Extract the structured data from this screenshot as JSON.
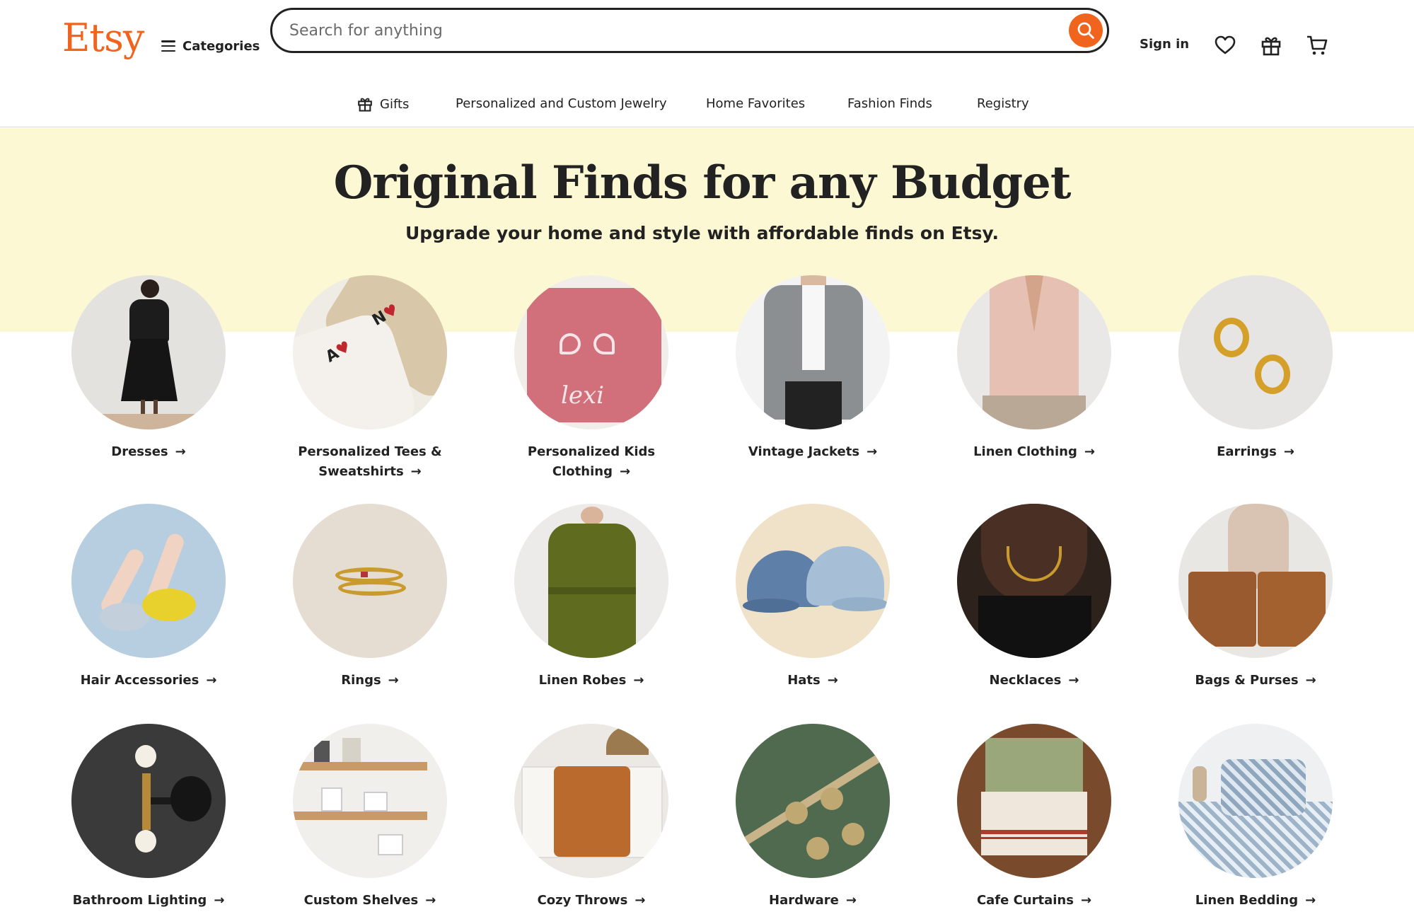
{
  "header": {
    "logo": "Etsy",
    "categories_label": "Categories",
    "search_placeholder": "Search for anything",
    "sign_in": "Sign in"
  },
  "subnav": [
    {
      "label": "Gifts"
    },
    {
      "label": "Personalized and Custom Jewelry"
    },
    {
      "label": "Home Favorites"
    },
    {
      "label": "Fashion Finds"
    },
    {
      "label": "Registry"
    }
  ],
  "hero": {
    "title": "Original Finds for any Budget",
    "subtitle": "Upgrade your home and style with affordable finds on Etsy."
  },
  "categories": [
    {
      "label": "Dresses"
    },
    {
      "label": "Personalized Tees & Sweatshirts"
    },
    {
      "label": "Personalized Kids Clothing"
    },
    {
      "label": "Vintage Jackets"
    },
    {
      "label": "Linen Clothing"
    },
    {
      "label": "Earrings"
    },
    {
      "label": "Hair Accessories"
    },
    {
      "label": "Rings"
    },
    {
      "label": "Linen Robes"
    },
    {
      "label": "Hats"
    },
    {
      "label": "Necklaces"
    },
    {
      "label": "Bags & Purses"
    },
    {
      "label": "Bathroom Lighting"
    },
    {
      "label": "Custom Shelves"
    },
    {
      "label": "Cozy Throws"
    },
    {
      "label": "Hardware"
    },
    {
      "label": "Cafe Curtains"
    },
    {
      "label": "Linen Bedding"
    }
  ],
  "colors": {
    "brand_orange": "#f1641e",
    "hero_background": "#fdf8d4",
    "text": "#222222"
  },
  "icons": [
    "hamburger-icon",
    "search-icon",
    "heart-icon",
    "gift-icon",
    "cart-icon",
    "arrow-right-icon"
  ]
}
